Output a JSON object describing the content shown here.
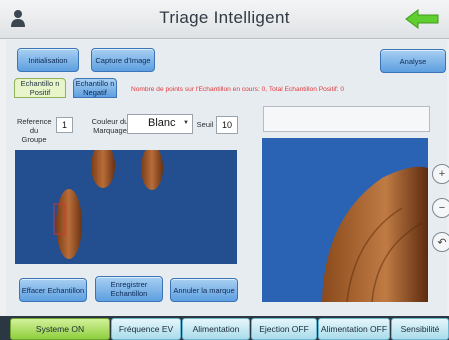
{
  "header": {
    "title": "Triage Intelligent"
  },
  "toolbar": {
    "initialisation": "Initialisation",
    "capture": "Capture d'Image",
    "analyse": "Analyse"
  },
  "tabs": {
    "positive": "Echantillo n Positif",
    "negative": "Echantillo n Negatif"
  },
  "status_message": "Nombre de points sur l'Echantillon en cours: 0, Total Echantillon Positif: 0",
  "settings": {
    "group_ref_label": "Reference du Groupe",
    "group_ref_value": "1",
    "marker_color_label": "Couleur du Marquage",
    "marker_color_value": "Blanc",
    "threshold_label": "Seuil",
    "threshold_value": "10"
  },
  "actions": {
    "clear": "Effacer Echantillon",
    "save": "Enregistrer Echantillon",
    "cancel_mark": "Annuler la marque"
  },
  "bottom_bar": [
    "Systeme ON",
    "Fréquence EV",
    "Alimentation",
    "Ejection OFF",
    "Alimentation OFF",
    "Sensibilité"
  ],
  "colors": {
    "accent_blue": "#5d9fe0",
    "status_red": "#e03a3a",
    "system_on": "#8fcf3e",
    "back_arrow": "#5fcf2f"
  }
}
